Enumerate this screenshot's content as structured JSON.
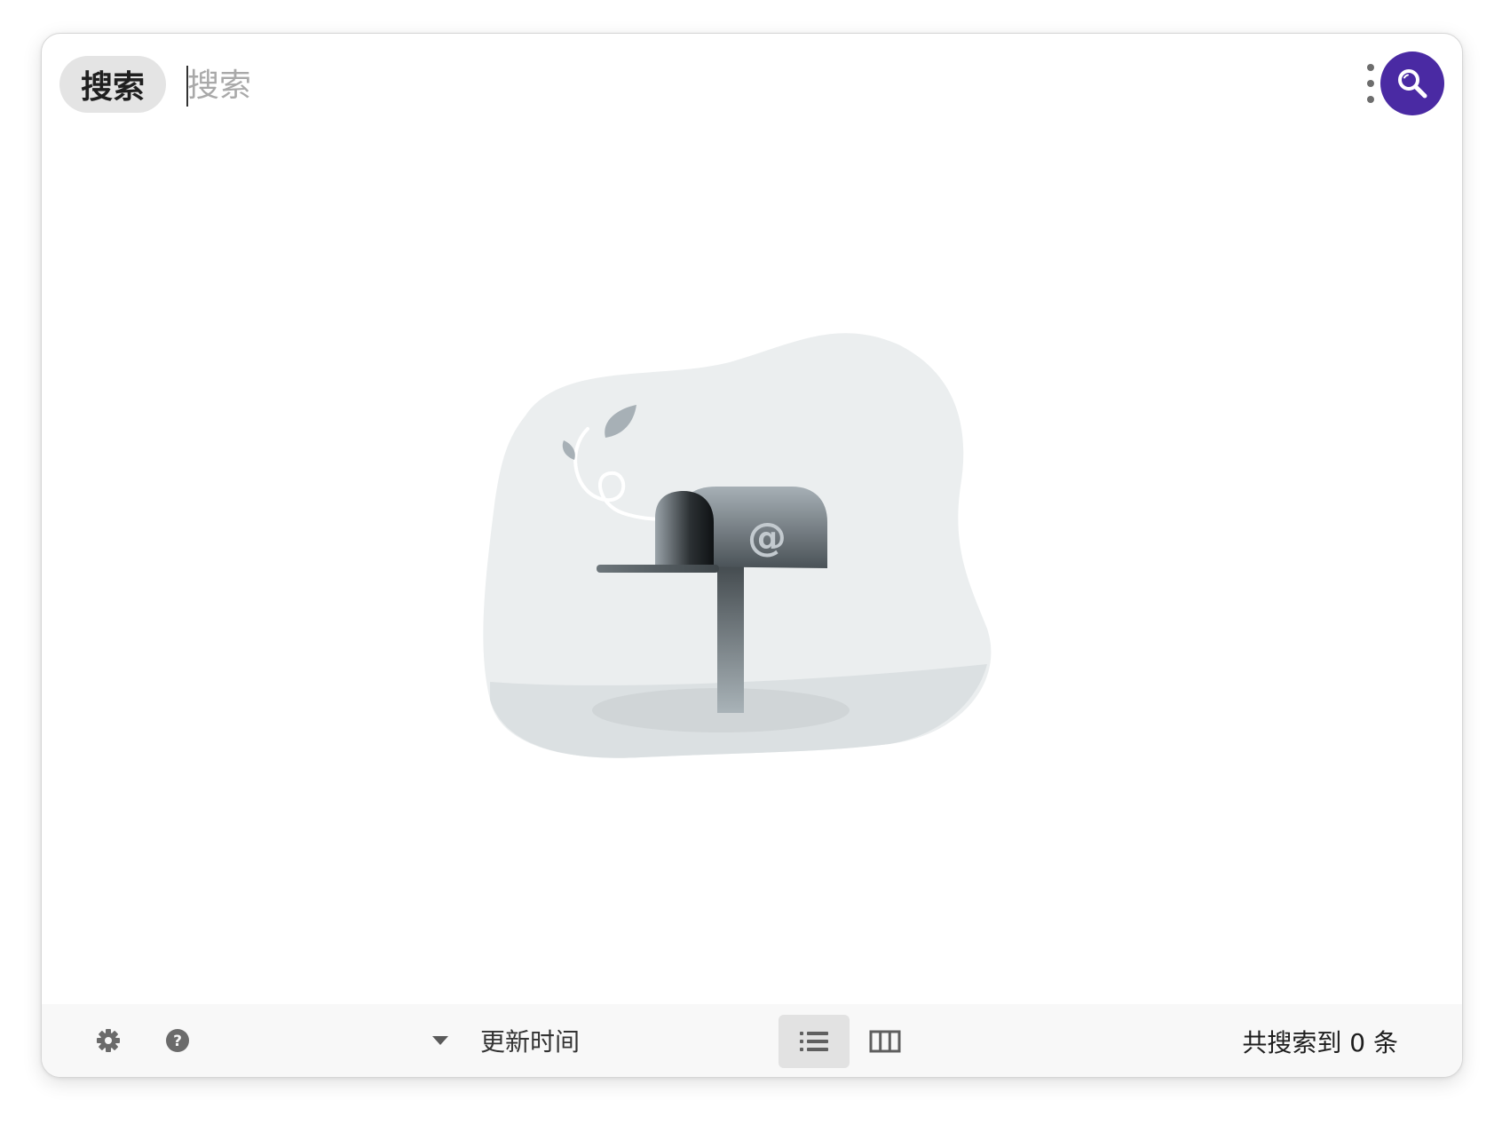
{
  "header": {
    "scope_chip_label": "搜索",
    "search_placeholder": "搜索",
    "search_value": ""
  },
  "icons": {
    "more": "more-vertical-icon",
    "search": "search-icon",
    "settings": "gear-icon",
    "help": "help-icon",
    "sort_dropdown": "caret-down-icon",
    "list_view": "list-view-icon",
    "column_view": "column-view-icon",
    "empty_state": "mailbox-illustration"
  },
  "colors": {
    "accent": "#4a2aa3",
    "chip_bg": "#e4e4e4",
    "footer_bg": "#f8f8f8"
  },
  "footer": {
    "sort_label": "更新时间",
    "view_mode": "list",
    "result_count_text": "共搜索到 0 条"
  }
}
